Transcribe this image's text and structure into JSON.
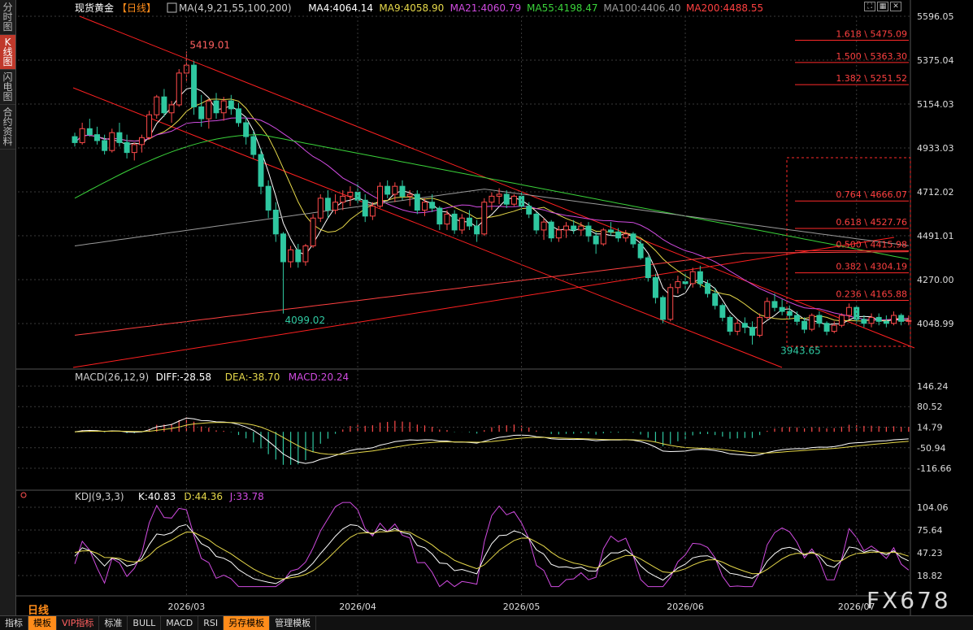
{
  "sidebar_tabs": [
    {
      "label": "分时图",
      "active": false
    },
    {
      "label": "K线图",
      "active": true
    },
    {
      "label": "闪电图",
      "active": false
    },
    {
      "label": "合约资料",
      "active": false
    }
  ],
  "header": {
    "instrument": "现货黄金",
    "period": "【日线】",
    "ma_items": [
      {
        "text": "MA(4,9,21,55,100,200)",
        "color": "#cccccc"
      },
      {
        "text": "MA4:4064.14",
        "color": "#ffffff"
      },
      {
        "text": "MA9:4058.90",
        "color": "#e6d84a"
      },
      {
        "text": "MA21:4060.79",
        "color": "#d04be0"
      },
      {
        "text": "MA55:4198.47",
        "color": "#3ad23a"
      },
      {
        "text": "MA100:4406.40",
        "color": "#9a9a9a"
      },
      {
        "text": "MA200:4488.55",
        "color": "#ff4040"
      }
    ]
  },
  "colors": {
    "up": "#ff4a4a",
    "down": "#2fc7a0",
    "grid": "#3a3a3a",
    "fib": "#ff2a2a"
  },
  "price_axis": [
    "5596.05",
    "5375.04",
    "5154.03",
    "4933.03",
    "4712.02",
    "4491.01",
    "4270.00",
    "4048.99"
  ],
  "annotations": {
    "high": "5419.01",
    "low1": "4099.02",
    "low2": "3943.65"
  },
  "fib_levels": [
    {
      "label": "1.618 \\ 5475.09",
      "price": 5475.09
    },
    {
      "label": "1.500 \\ 5363.30",
      "price": 5363.3
    },
    {
      "label": "1.382 \\ 5251.52",
      "price": 5251.52
    },
    {
      "label": "0.764 \\ 4666.07",
      "price": 4666.07
    },
    {
      "label": "0.618 \\ 4527.76",
      "price": 4527.76
    },
    {
      "label": "0.500 \\ 4415.98",
      "price": 4415.98
    },
    {
      "label": "0.382 \\ 4304.19",
      "price": 4304.19
    },
    {
      "label": "0.236 \\ 4165.88",
      "price": 4165.88
    }
  ],
  "macd": {
    "header": [
      {
        "text": "MACD(26,12,9)",
        "color": "#cccccc"
      },
      {
        "text": "DIFF:-28.58",
        "color": "#ffffff"
      },
      {
        "text": "DEA:-38.70",
        "color": "#e6d84a"
      },
      {
        "text": "MACD:20.24",
        "color": "#d04be0"
      }
    ],
    "axis": [
      "146.24",
      "80.52",
      "14.79",
      "-50.94",
      "-116.66"
    ]
  },
  "kdj": {
    "header": [
      {
        "text": "KDJ(9,3,3)",
        "color": "#cccccc"
      },
      {
        "text": "K:40.83",
        "color": "#ffffff"
      },
      {
        "text": "D:44.36",
        "color": "#e6d84a"
      },
      {
        "text": "J:33.78",
        "color": "#d04be0"
      }
    ],
    "axis": [
      "104.06",
      "75.64",
      "47.23",
      "18.82"
    ]
  },
  "date_axis": [
    {
      "label": "2026/03",
      "index": 15
    },
    {
      "label": "2026/04",
      "index": 38
    },
    {
      "label": "2026/05",
      "index": 60
    },
    {
      "label": "2026/06",
      "index": 82
    },
    {
      "label": "2026/07",
      "index": 105
    }
  ],
  "period_label": "日线",
  "toolbar": [
    {
      "label": "指标",
      "active": false,
      "vip": false
    },
    {
      "label": "模板",
      "active": true,
      "vip": false
    },
    {
      "label": "VIP指标",
      "active": false,
      "vip": true
    },
    {
      "label": "标准",
      "active": false,
      "vip": false
    },
    {
      "label": "BULL",
      "active": false,
      "vip": false
    },
    {
      "label": "MACD",
      "active": false,
      "vip": false
    },
    {
      "label": "RSI",
      "active": false,
      "vip": false
    },
    {
      "label": "另存模板",
      "active": true,
      "vip": false
    },
    {
      "label": "管理模板",
      "active": false,
      "vip": false
    }
  ],
  "logo": "FX678",
  "window_buttons": [
    {
      "icon": "fullscreen-icon",
      "glyph": "⛶"
    },
    {
      "icon": "grid-icon",
      "glyph": "▦"
    },
    {
      "icon": "close-icon",
      "glyph": "✕"
    }
  ],
  "chart_data": {
    "type": "candlestick",
    "candles": [
      [
        4990,
        5010,
        4940,
        4960
      ],
      [
        4960,
        5060,
        4950,
        5030
      ],
      [
        5030,
        5080,
        4990,
        5000
      ],
      [
        5000,
        5040,
        4950,
        4970
      ],
      [
        4970,
        5000,
        4900,
        4920
      ],
      [
        4920,
        5030,
        4910,
        5010
      ],
      [
        5010,
        5060,
        4940,
        4960
      ],
      [
        4960,
        5000,
        4880,
        4910
      ],
      [
        4910,
        4960,
        4870,
        4950
      ],
      [
        4950,
        5000,
        4910,
        4985
      ],
      [
        4985,
        5120,
        4975,
        5100
      ],
      [
        5100,
        5200,
        5080,
        5190
      ],
      [
        5190,
        5230,
        5090,
        5110
      ],
      [
        5110,
        5170,
        5060,
        5150
      ],
      [
        5150,
        5330,
        5140,
        5310
      ],
      [
        5310,
        5419,
        5270,
        5350
      ],
      [
        5350,
        5370,
        5100,
        5140
      ],
      [
        5140,
        5200,
        5040,
        5080
      ],
      [
        5080,
        5180,
        5030,
        5170
      ],
      [
        5170,
        5210,
        5080,
        5110
      ],
      [
        5110,
        5190,
        5070,
        5170
      ],
      [
        5170,
        5200,
        5100,
        5130
      ],
      [
        5130,
        5160,
        5040,
        5060
      ],
      [
        5060,
        5090,
        4950,
        4990
      ],
      [
        4990,
        5020,
        4880,
        4900
      ],
      [
        4900,
        4930,
        4700,
        4740
      ],
      [
        4740,
        4770,
        4580,
        4620
      ],
      [
        4620,
        4660,
        4460,
        4500
      ],
      [
        4500,
        4510,
        4099,
        4360
      ],
      [
        4360,
        4440,
        4330,
        4420
      ],
      [
        4420,
        4450,
        4330,
        4360
      ],
      [
        4360,
        4450,
        4340,
        4440
      ],
      [
        4440,
        4600,
        4430,
        4580
      ],
      [
        4580,
        4700,
        4560,
        4680
      ],
      [
        4680,
        4720,
        4580,
        4620
      ],
      [
        4620,
        4700,
        4600,
        4660
      ],
      [
        4660,
        4720,
        4620,
        4690
      ],
      [
        4690,
        4740,
        4640,
        4710
      ],
      [
        4710,
        4760,
        4650,
        4670
      ],
      [
        4670,
        4700,
        4560,
        4590
      ],
      [
        4590,
        4660,
        4570,
        4640
      ],
      [
        4640,
        4760,
        4630,
        4740
      ],
      [
        4740,
        4770,
        4680,
        4700
      ],
      [
        4700,
        4760,
        4660,
        4740
      ],
      [
        4740,
        4770,
        4670,
        4690
      ],
      [
        4690,
        4720,
        4640,
        4700
      ],
      [
        4700,
        4720,
        4600,
        4620
      ],
      [
        4620,
        4680,
        4590,
        4660
      ],
      [
        4660,
        4700,
        4610,
        4630
      ],
      [
        4630,
        4640,
        4520,
        4550
      ],
      [
        4550,
        4620,
        4520,
        4600
      ],
      [
        4600,
        4620,
        4500,
        4520
      ],
      [
        4520,
        4600,
        4500,
        4580
      ],
      [
        4580,
        4620,
        4520,
        4540
      ],
      [
        4540,
        4570,
        4460,
        4500
      ],
      [
        4500,
        4680,
        4490,
        4660
      ],
      [
        4660,
        4710,
        4620,
        4690
      ],
      [
        4690,
        4730,
        4650,
        4700
      ],
      [
        4700,
        4720,
        4630,
        4650
      ],
      [
        4650,
        4700,
        4640,
        4690
      ],
      [
        4690,
        4710,
        4620,
        4640
      ],
      [
        4640,
        4660,
        4580,
        4600
      ],
      [
        4600,
        4610,
        4500,
        4520
      ],
      [
        4520,
        4580,
        4470,
        4560
      ],
      [
        4560,
        4570,
        4460,
        4480
      ],
      [
        4480,
        4540,
        4460,
        4520
      ],
      [
        4520,
        4560,
        4480,
        4540
      ],
      [
        4540,
        4570,
        4500,
        4520
      ],
      [
        4520,
        4560,
        4490,
        4540
      ],
      [
        4540,
        4560,
        4460,
        4490
      ],
      [
        4490,
        4510,
        4400,
        4450
      ],
      [
        4450,
        4530,
        4440,
        4520
      ],
      [
        4520,
        4560,
        4490,
        4510
      ],
      [
        4510,
        4530,
        4460,
        4480
      ],
      [
        4480,
        4520,
        4460,
        4500
      ],
      [
        4500,
        4510,
        4430,
        4450
      ],
      [
        4450,
        4470,
        4370,
        4380
      ],
      [
        4380,
        4390,
        4260,
        4280
      ],
      [
        4280,
        4300,
        4150,
        4180
      ],
      [
        4180,
        4190,
        4050,
        4070
      ],
      [
        4070,
        4250,
        4060,
        4230
      ],
      [
        4230,
        4290,
        4200,
        4260
      ],
      [
        4260,
        4300,
        4220,
        4250
      ],
      [
        4250,
        4330,
        4230,
        4310
      ],
      [
        4310,
        4340,
        4230,
        4250
      ],
      [
        4250,
        4270,
        4180,
        4200
      ],
      [
        4200,
        4230,
        4120,
        4140
      ],
      [
        4140,
        4150,
        4060,
        4080
      ],
      [
        4080,
        4090,
        3990,
        4010
      ],
      [
        4010,
        4070,
        3990,
        4050
      ],
      [
        4050,
        4080,
        4000,
        4030
      ],
      [
        4030,
        4060,
        3943,
        3990
      ],
      [
        3990,
        4100,
        3980,
        4080
      ],
      [
        4080,
        4180,
        4070,
        4160
      ],
      [
        4160,
        4200,
        4110,
        4130
      ],
      [
        4130,
        4170,
        4090,
        4110
      ],
      [
        4110,
        4140,
        4070,
        4090
      ],
      [
        4090,
        4110,
        4040,
        4060
      ],
      [
        4060,
        4080,
        4000,
        4020
      ],
      [
        4020,
        4100,
        4010,
        4090
      ],
      [
        4090,
        4110,
        4030,
        4050
      ],
      [
        4050,
        4060,
        3990,
        4010
      ],
      [
        4010,
        4060,
        4000,
        4040
      ],
      [
        4040,
        4100,
        4030,
        4090
      ],
      [
        4090,
        4150,
        4070,
        4130
      ],
      [
        4130,
        4140,
        4050,
        4070
      ],
      [
        4070,
        4090,
        4030,
        4050
      ],
      [
        4050,
        4100,
        4030,
        4080
      ],
      [
        4080,
        4100,
        4040,
        4060
      ],
      [
        4060,
        4090,
        4030,
        4050
      ],
      [
        4050,
        4110,
        4040,
        4090
      ],
      [
        4090,
        4100,
        4040,
        4060
      ],
      [
        4060,
        4090,
        4040,
        4064
      ]
    ]
  }
}
